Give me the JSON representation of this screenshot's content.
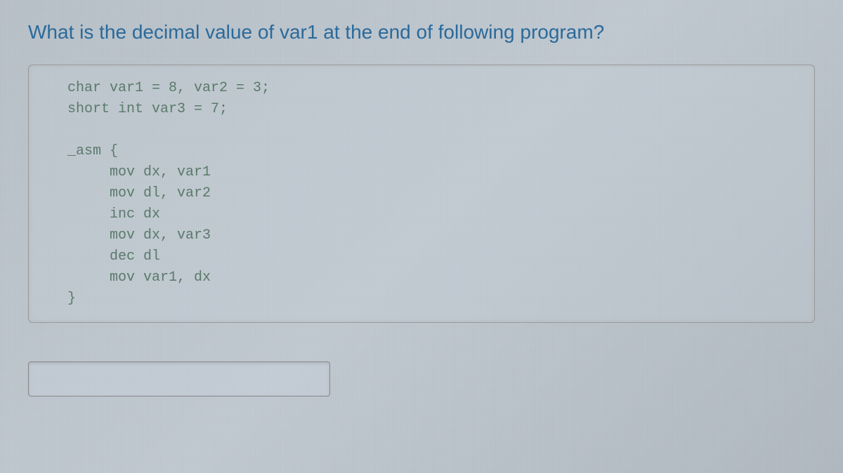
{
  "question": "What is the decimal value of var1 at the end of following program?",
  "code": {
    "line1": "char var1 = 8, var2 = 3;",
    "line2": "short int var3 = 7;",
    "line3": "_asm {",
    "line4": "     mov dx, var1",
    "line5": "     mov dl, var2",
    "line6": "     inc dx",
    "line7": "     mov dx, var3",
    "line8": "     dec dl",
    "line9": "     mov var1, dx",
    "line10": "}"
  },
  "answer_value": "",
  "answer_placeholder": ""
}
